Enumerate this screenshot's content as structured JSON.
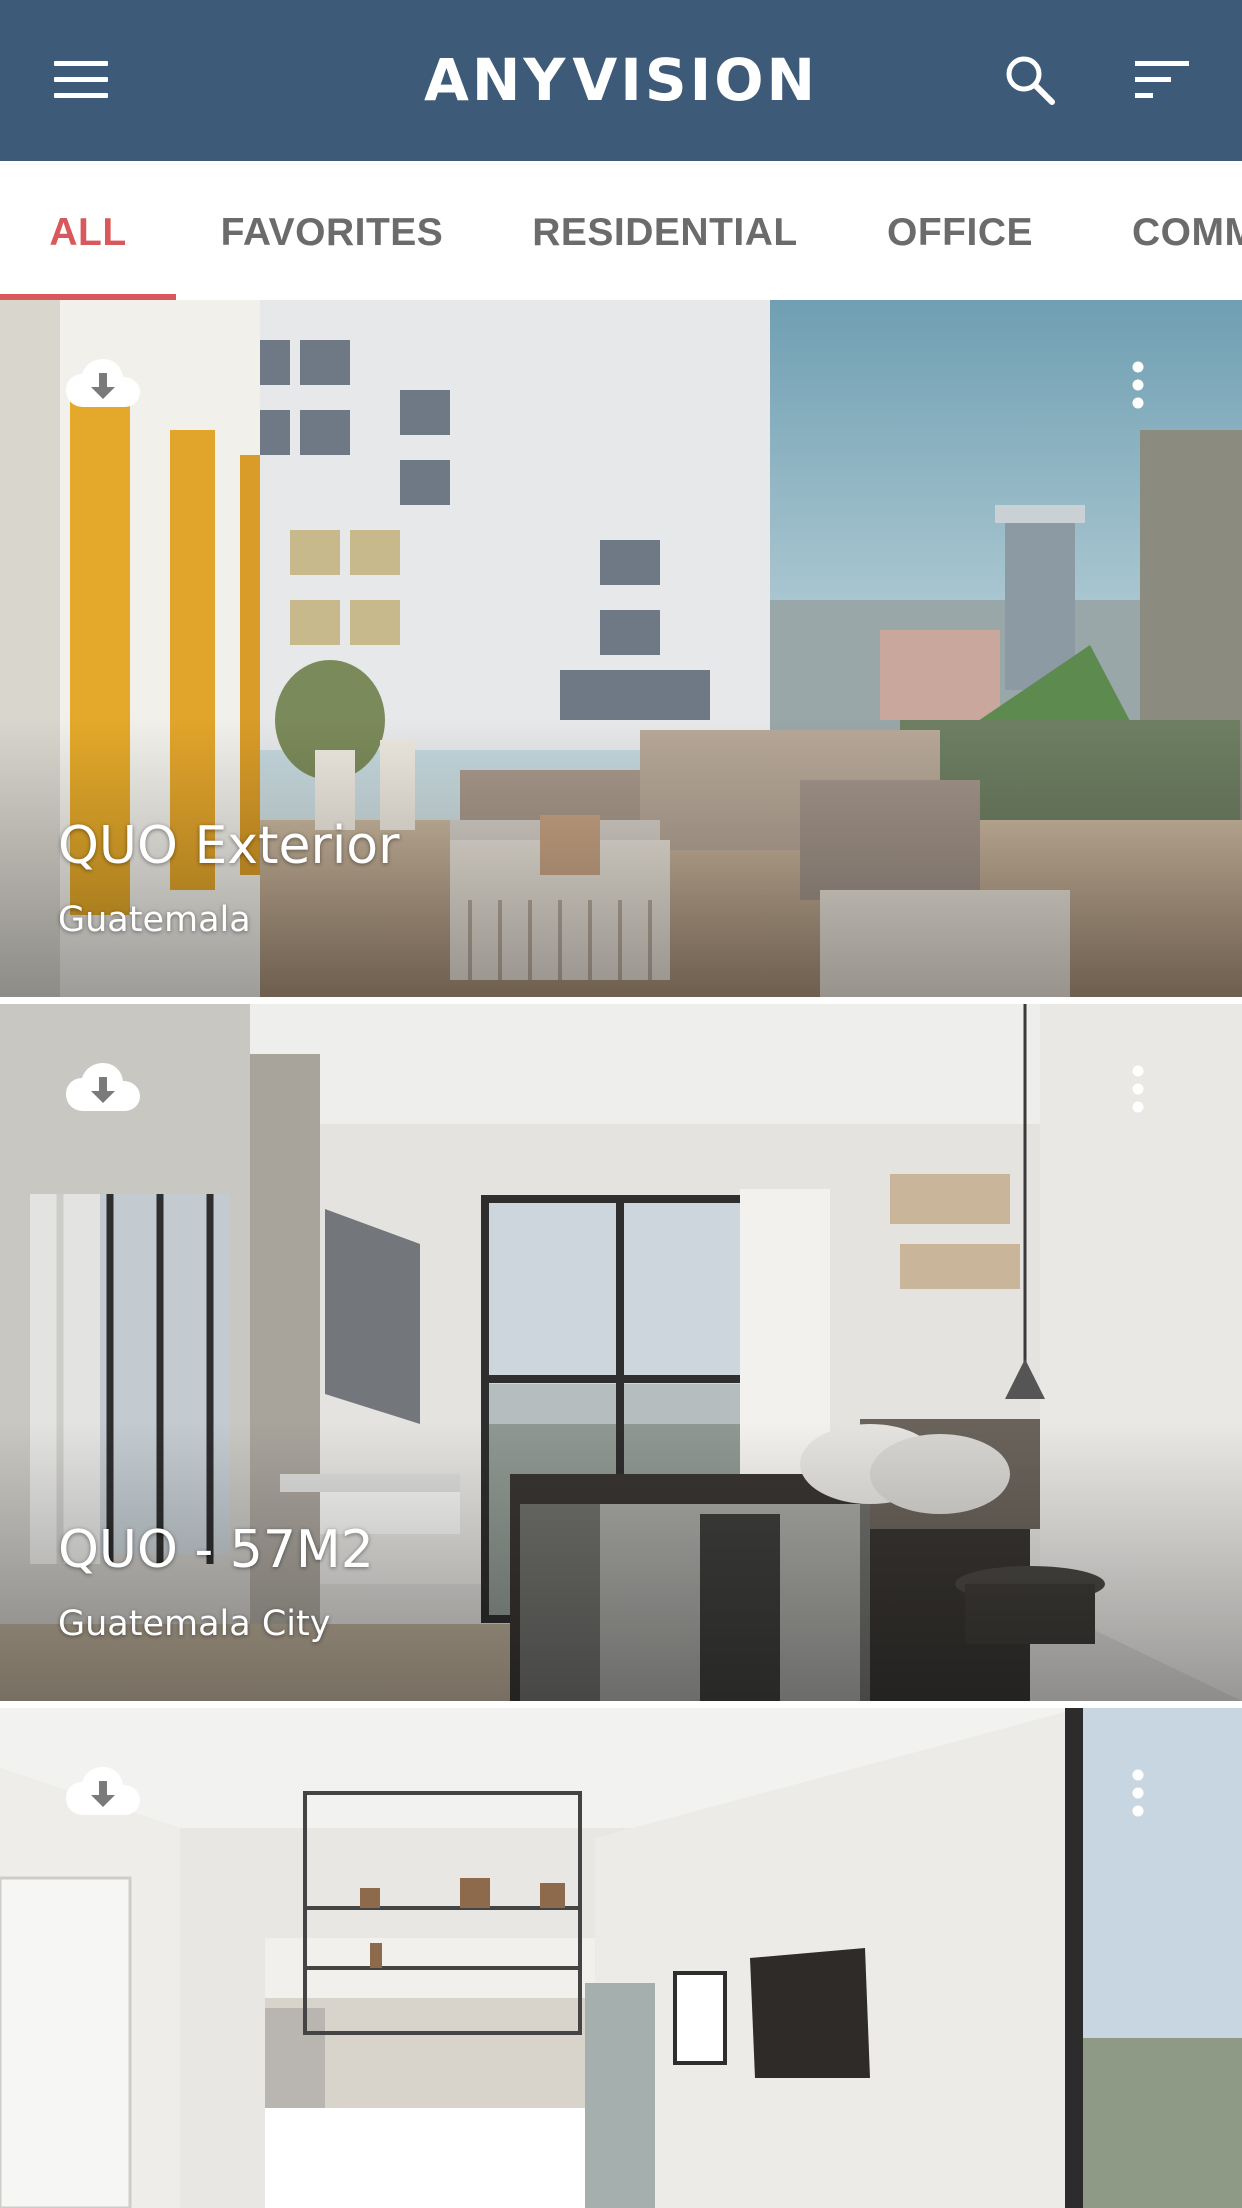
{
  "app": {
    "logo_text_left": "ANY",
    "logo_text_right": "VISION",
    "brand_color": "#3d5a78",
    "accent_color": "#d9585b",
    "icons": {
      "menu": "hamburger-menu-icon",
      "search": "search-icon",
      "sort": "sort-filter-icon"
    }
  },
  "tabs": [
    {
      "label": "ALL",
      "active": true
    },
    {
      "label": "FAVORITES",
      "active": false
    },
    {
      "label": "RESIDENTIAL",
      "active": false
    },
    {
      "label": "OFFICE",
      "active": false
    },
    {
      "label": "COMM",
      "active": false
    }
  ],
  "projects": [
    {
      "title": "QUO Exterior",
      "location": "Guatemala",
      "icons": [
        "cloud-download-icon",
        "more-vertical-icon"
      ]
    },
    {
      "title": "QUO - 57M2",
      "location": "Guatemala City",
      "icons": [
        "cloud-download-icon",
        "more-vertical-icon"
      ]
    },
    {
      "title": "",
      "location": "",
      "icons": [
        "cloud-download-icon",
        "more-vertical-icon"
      ]
    }
  ]
}
